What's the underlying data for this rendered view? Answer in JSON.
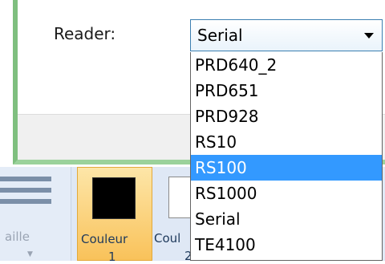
{
  "dialog": {
    "reader_label": "Reader:",
    "combo_value": "Serial",
    "options": [
      "PRD640_2",
      "PRD651",
      "PRD928",
      "RS10",
      "RS100",
      "RS1000",
      "Serial",
      "TE4100"
    ],
    "selected_index": 4
  },
  "ribbon": {
    "taille_label": "aille",
    "couleur1_label": "Couleur",
    "couleur1_num": "1",
    "couleur2_label": "Coul",
    "couleur2_num": "2"
  },
  "colors": {
    "selection": "#3399ff",
    "ribbon_highlight": "#f9c25a",
    "dialog_border": "#7fbf7f"
  }
}
